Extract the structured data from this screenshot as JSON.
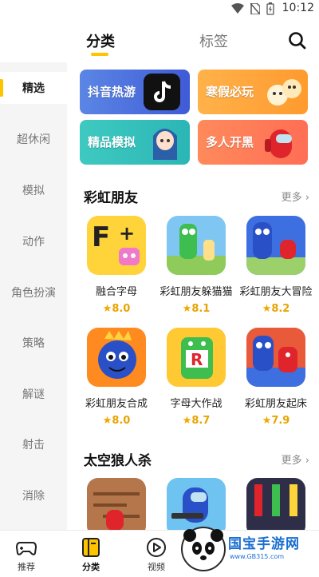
{
  "status_bar": {
    "time": "10:12"
  },
  "top_tabs": [
    {
      "label": "分类",
      "active": true
    },
    {
      "label": "标签",
      "active": false
    }
  ],
  "sidebar": {
    "items": [
      {
        "label": "精选",
        "active": true
      },
      {
        "label": "超休闲",
        "active": false
      },
      {
        "label": "模拟",
        "active": false
      },
      {
        "label": "动作",
        "active": false
      },
      {
        "label": "角色扮演",
        "active": false
      },
      {
        "label": "策略",
        "active": false
      },
      {
        "label": "解谜",
        "active": false
      },
      {
        "label": "射击",
        "active": false
      },
      {
        "label": "消除",
        "active": false
      }
    ]
  },
  "banners": [
    {
      "label": "抖音热游",
      "color": "#4A6FE0"
    },
    {
      "label": "寒假必玩",
      "color": "#FFA93B"
    },
    {
      "label": "精品模拟",
      "color": "#35C2BC"
    },
    {
      "label": "多人开黑",
      "color": "#FF7A58"
    }
  ],
  "sections": [
    {
      "title": "彩虹朋友",
      "more": "更多",
      "games": [
        {
          "name": "融合字母",
          "rating": "8.0"
        },
        {
          "name": "彩虹朋友躲猫猫",
          "rating": "8.1"
        },
        {
          "name": "彩虹朋友大冒险",
          "rating": "8.2"
        },
        {
          "name": "彩虹朋友合成",
          "rating": "8.0"
        },
        {
          "name": "字母大作战",
          "rating": "8.7"
        },
        {
          "name": "彩虹朋友起床",
          "rating": "7.9"
        }
      ]
    },
    {
      "title": "太空狼人杀",
      "more": "更多",
      "games": [
        {},
        {},
        {}
      ]
    }
  ],
  "bottom_nav": [
    {
      "label": "推荐",
      "active": false
    },
    {
      "label": "分类",
      "active": true
    },
    {
      "label": "视频",
      "active": false
    }
  ],
  "watermark": {
    "text": "国宝手游网",
    "url": "www.GB315.com"
  },
  "colors": {
    "accent": "#FFC400",
    "rating": "#E8A400",
    "sidebar_bg": "#F5F5F5"
  }
}
